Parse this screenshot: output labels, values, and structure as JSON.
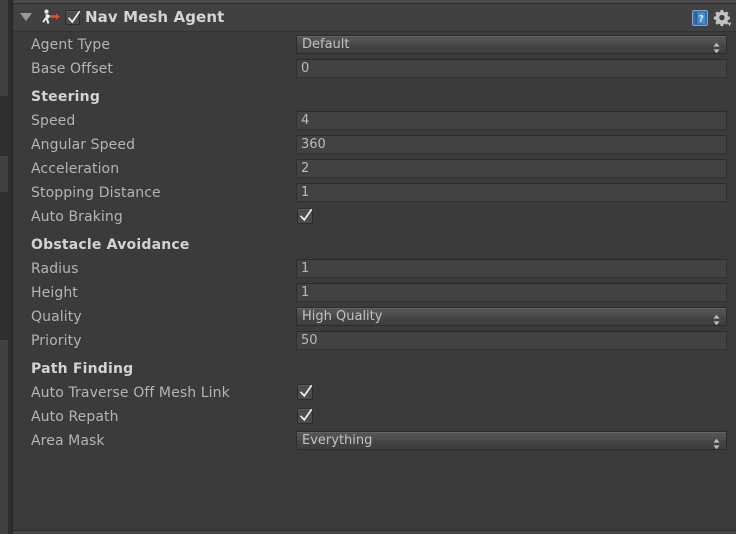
{
  "panel": {
    "component_title": "Nav Mesh Agent",
    "component_icon": "nav-mesh-agent-icon",
    "enabled": true,
    "expanded": true,
    "foldout_icon": "triangle-down-icon",
    "help_icon": "help-book-icon",
    "settings_icon": "gear-icon",
    "colors": {
      "background": "#3b3b3b",
      "header": "#414141",
      "field": "#424242",
      "label_text": "#b4b4b4",
      "section_text": "#d3d3d3",
      "value_text": "#b9b9b9",
      "help_accent": "#4a90d9",
      "icon_arrow": "#e8502a"
    }
  },
  "rows": [
    {
      "label": "Agent Type",
      "type": "popup",
      "value": "Default",
      "section": false,
      "name": "agent-type"
    },
    {
      "label": "Base Offset",
      "type": "field",
      "value": "0",
      "section": false,
      "name": "base-offset"
    },
    {
      "label": "Steering",
      "type": "section",
      "value": "",
      "section": true,
      "name": "steering"
    },
    {
      "label": "Speed",
      "type": "field",
      "value": "4",
      "section": false,
      "name": "speed"
    },
    {
      "label": "Angular Speed",
      "type": "field",
      "value": "360",
      "section": false,
      "name": "angular-speed"
    },
    {
      "label": "Acceleration",
      "type": "field",
      "value": "2",
      "section": false,
      "name": "acceleration"
    },
    {
      "label": "Stopping Distance",
      "type": "field",
      "value": "1",
      "section": false,
      "name": "stopping-distance"
    },
    {
      "label": "Auto Braking",
      "type": "checkbox",
      "value": true,
      "section": false,
      "name": "auto-braking"
    },
    {
      "label": "Obstacle Avoidance",
      "type": "section",
      "value": "",
      "section": true,
      "name": "obstacle-avoidance"
    },
    {
      "label": "Radius",
      "type": "field",
      "value": "1",
      "section": false,
      "name": "radius"
    },
    {
      "label": "Height",
      "type": "field",
      "value": "1",
      "section": false,
      "name": "height"
    },
    {
      "label": "Quality",
      "type": "popup",
      "value": "High Quality",
      "section": false,
      "name": "quality"
    },
    {
      "label": "Priority",
      "type": "field",
      "value": "50",
      "section": false,
      "name": "priority"
    },
    {
      "label": "Path Finding",
      "type": "section",
      "value": "",
      "section": true,
      "name": "path-finding"
    },
    {
      "label": "Auto Traverse Off Mesh Link",
      "type": "checkbox",
      "value": true,
      "section": false,
      "name": "auto-traverse-off-mesh-link"
    },
    {
      "label": "Auto Repath",
      "type": "checkbox",
      "value": true,
      "section": false,
      "name": "auto-repath"
    },
    {
      "label": "Area Mask",
      "type": "popup",
      "value": "Everything",
      "section": false,
      "name": "area-mask"
    }
  ]
}
